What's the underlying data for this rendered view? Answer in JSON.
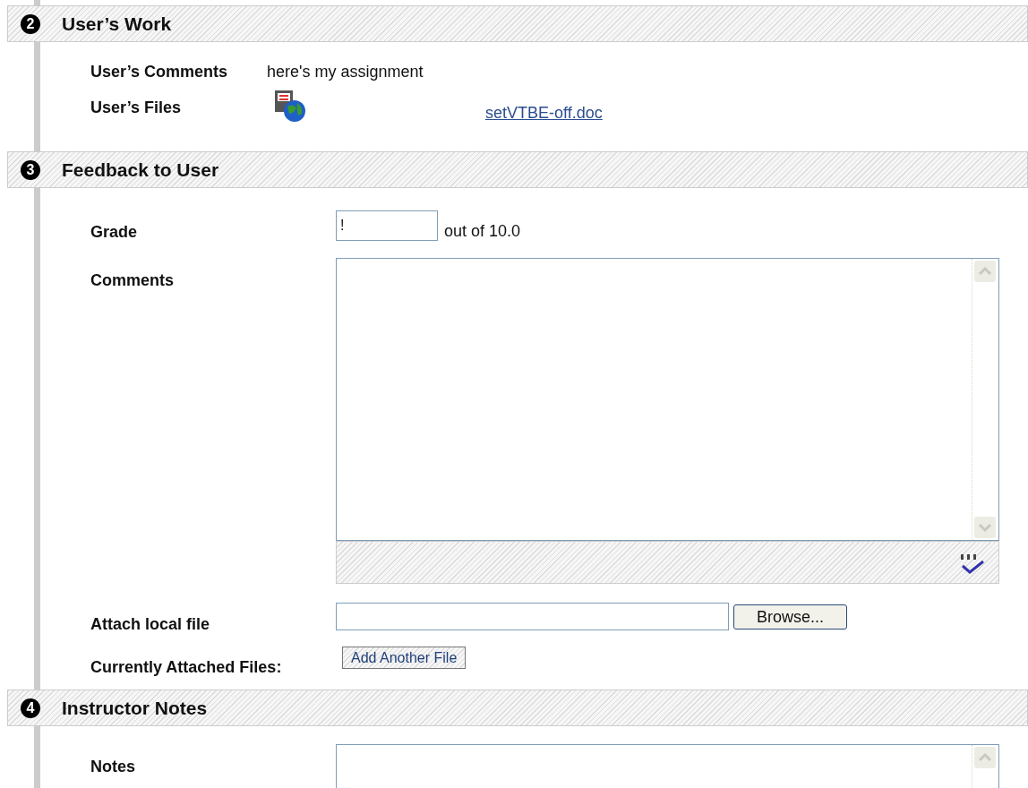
{
  "sections": [
    {
      "number": "2",
      "title": "User’s Work",
      "rows": [
        {
          "kind": "text",
          "label": "User’s Comments",
          "value": "here's my assignment"
        },
        {
          "kind": "file",
          "label": "User’s Files",
          "link": "setVTBE-off.doc"
        }
      ]
    },
    {
      "number": "3",
      "title": "Feedback to User",
      "rows": [
        {
          "kind": "grade",
          "label": "Grade",
          "value": "!",
          "suffix": "out of 10.0"
        },
        {
          "kind": "editor",
          "label": "Comments"
        },
        {
          "kind": "upload",
          "label": "Attach local file",
          "button": "Browse..."
        },
        {
          "kind": "attach",
          "label": "Currently Attached Files:",
          "button": "Add Another File"
        }
      ]
    },
    {
      "number": "4",
      "title": "Instructor Notes",
      "rows": [
        {
          "kind": "notes",
          "label": "Notes"
        }
      ]
    }
  ]
}
